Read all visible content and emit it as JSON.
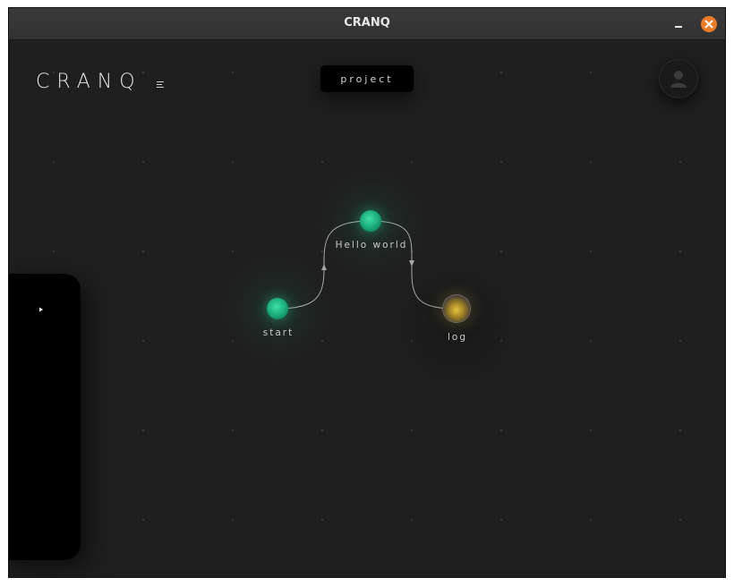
{
  "window": {
    "title": "CRANQ"
  },
  "header": {
    "logo_text": "CRANQ",
    "project_label": "project"
  },
  "nodes": [
    {
      "id": "start",
      "label": "start",
      "color": "#1fbf88"
    },
    {
      "id": "hello",
      "label": "Hello world",
      "color": "#1fbf88"
    },
    {
      "id": "log",
      "label": "log",
      "color": "#d6b23a"
    }
  ],
  "icons": {
    "menu": "hamburger-menu-icon",
    "avatar": "user-avatar-icon",
    "close": "close-icon",
    "minimize": "minimize-icon"
  },
  "colors": {
    "background": "#1f1f1f",
    "accent_green": "#1fbf88",
    "close_orange": "#f07a23",
    "panel": "#000000"
  }
}
